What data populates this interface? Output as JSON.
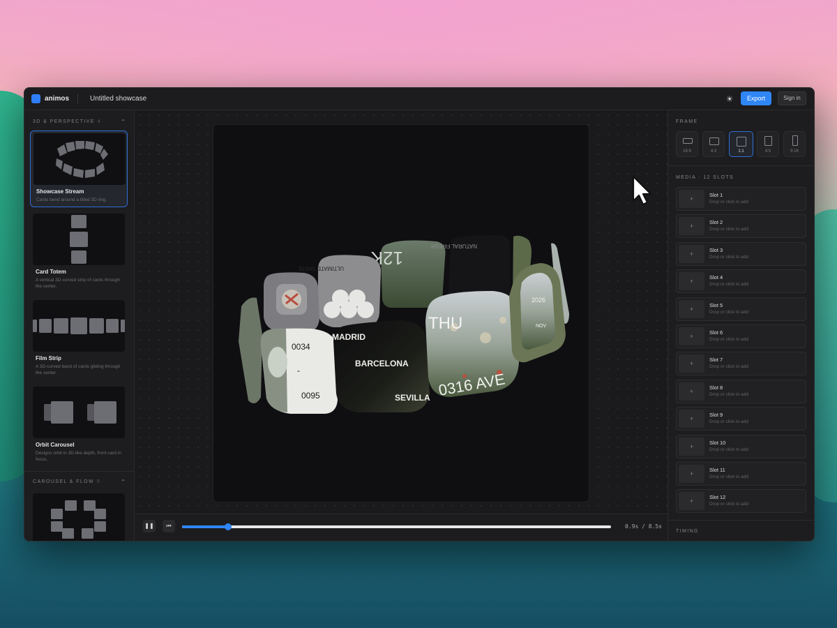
{
  "app": {
    "name": "animos",
    "document_title": "Untitled showcase"
  },
  "topbar": {
    "theme_icon": "sun-icon",
    "export_label": "Export",
    "signin_label": "Sign in"
  },
  "sidebar": {
    "sections": [
      {
        "title": "3D & PERSPECTIVE",
        "count": "4"
      },
      {
        "title": "CAROUSEL & FLOW",
        "count": "5"
      }
    ],
    "templates": [
      {
        "title": "Showcase Stream",
        "desc": "Cards bend around a tilted 3D ring.",
        "selected": true
      },
      {
        "title": "Card Totem",
        "desc": "A vertical 3D-curved strip of cards through the center."
      },
      {
        "title": "Film Strip",
        "desc": "A 3D-curved band of cards gliding through the center."
      },
      {
        "title": "Orbit Carousel",
        "desc": "Designs orbit in 3D-like depth, front card in focus."
      }
    ]
  },
  "canvas": {
    "card_texts": {
      "madrid": "MADRID",
      "barcelona": "BARCELONA",
      "sevilla": "SEVILLA",
      "num_a": "0034",
      "dash": "-",
      "num_b": "0095",
      "thu": "THU",
      "ave": "0316 AVE",
      "k": "12K",
      "taste": "ULTIMATE TASTE",
      "natural": "NATURAL FRESH",
      "year": "2026",
      "nov": "NOV"
    }
  },
  "playback": {
    "time_label": "0.9s / 8.5s",
    "progress": 0.108,
    "pause_icon": "pause-icon",
    "restart_icon": "skip-back-icon"
  },
  "frame": {
    "title": "FRAME",
    "ratios": [
      {
        "label": "16:9"
      },
      {
        "label": "4:3"
      },
      {
        "label": "1:1",
        "selected": true
      },
      {
        "label": "4:5"
      },
      {
        "label": "9:16"
      }
    ]
  },
  "media": {
    "title": "MEDIA · 12 SLOTS",
    "add_label": "+",
    "hint": "Drop or click to add",
    "slots": [
      "Slot 1",
      "Slot 2",
      "Slot 3",
      "Slot 4",
      "Slot 5",
      "Slot 6",
      "Slot 7",
      "Slot 8",
      "Slot 9",
      "Slot 10",
      "Slot 11",
      "Slot 12"
    ]
  },
  "timing": {
    "title": "TIMING"
  },
  "colors": {
    "accent": "#2f86f6",
    "panel": "#1d1d1f",
    "canvas": "#0f0f12"
  }
}
